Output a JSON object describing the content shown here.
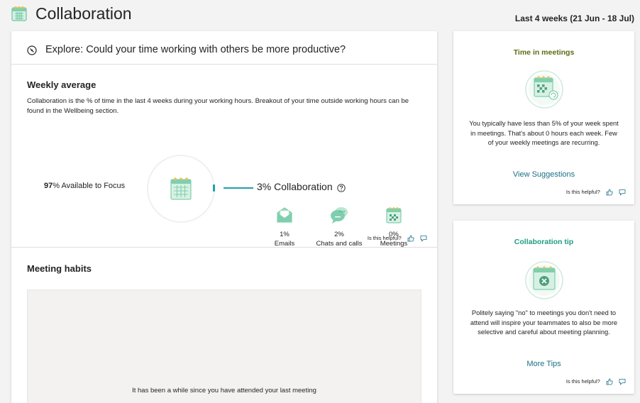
{
  "header": {
    "title": "Collaboration",
    "date_range": "Last 4 weeks (21 Jun - 18 Jul)",
    "icon": "calendar-icon"
  },
  "explore": {
    "text": "Explore: Could your time working with others be more productive?",
    "icon": "explore-compass-icon"
  },
  "weekly": {
    "title": "Weekly average",
    "description": "Collaboration is the % of time in the last 4 weeks during your working hours. Breakout of your time outside working hours can be found in the Wellbeing section.",
    "focus_percent": "97",
    "focus_label": "% Available to Focus",
    "collab_label": "3% Collaboration",
    "collaboration_fraction": 0.03,
    "stats": [
      {
        "percent": "1%",
        "label": "Emails",
        "icon": "email-icon"
      },
      {
        "percent": "2%",
        "label": "Chats and calls",
        "icon": "chat-icon"
      },
      {
        "percent": "0%",
        "label": "Meetings",
        "icon": "meetings-calendar-icon"
      }
    ],
    "helpful": "Is this helpful?"
  },
  "habits": {
    "title": "Meeting habits",
    "empty_text": "It has been a while since you have attended your last meeting"
  },
  "side_cards": [
    {
      "title": "Time in meetings",
      "text": "You typically have less than 5% of your week spent in meetings. That's about 0 hours each week. Few of your weekly meetings are recurring.",
      "link": "View Suggestions",
      "helpful": "Is this helpful?"
    },
    {
      "title": "Collaboration tip",
      "text": "Politely saying \"no\" to meetings you don't need to attend will inspire your teammates to also be more selective and careful about meeting planning.",
      "link": "More Tips",
      "helpful": "Is this helpful?"
    }
  ],
  "colors": {
    "accent_teal": "#1ea0a8",
    "link": "#1b6f85",
    "illustration_green": "#7fcfae",
    "title_olive": "#5d6b14",
    "title_green": "#1e9c82"
  }
}
